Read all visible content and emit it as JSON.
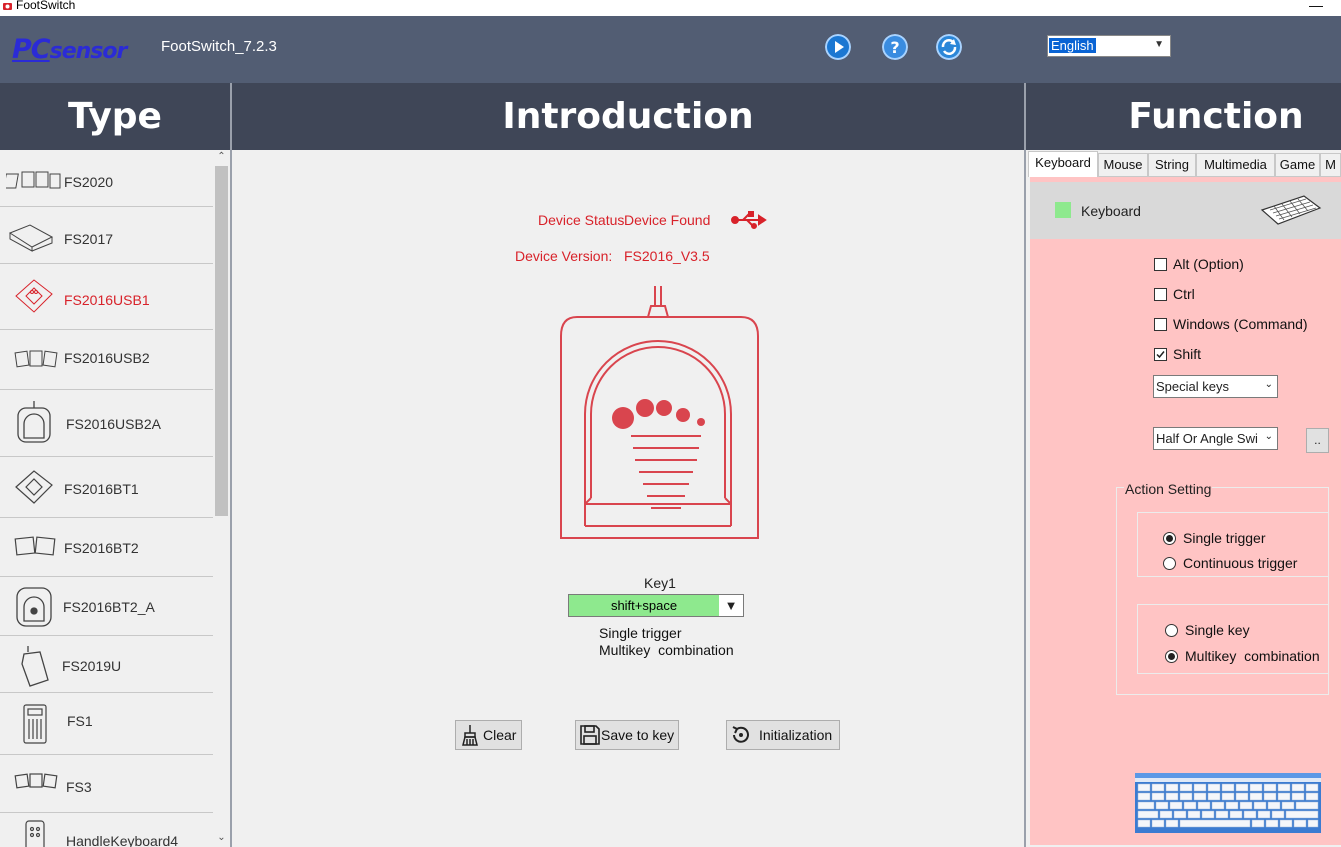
{
  "window": {
    "title": "FootSwitch"
  },
  "header": {
    "app_name": "FootSwitch_7.2.3",
    "logo_text": "PCsensor",
    "language": "English"
  },
  "sections": {
    "type": "Type",
    "introduction": "Introduction",
    "function": "Function"
  },
  "devices": [
    {
      "name": "FS2020",
      "selected": false
    },
    {
      "name": "FS2017",
      "selected": false
    },
    {
      "name": "FS2016USB1",
      "selected": true
    },
    {
      "name": "FS2016USB2",
      "selected": false
    },
    {
      "name": "FS2016USB2A",
      "selected": false
    },
    {
      "name": "FS2016BT1",
      "selected": false
    },
    {
      "name": "FS2016BT2",
      "selected": false
    },
    {
      "name": "FS2016BT2_A",
      "selected": false
    },
    {
      "name": "FS2019U",
      "selected": false
    },
    {
      "name": "FS1",
      "selected": false
    },
    {
      "name": "FS3",
      "selected": false
    },
    {
      "name": "HandleKeyboard4",
      "selected": false
    }
  ],
  "intro": {
    "status_label": "Device Status",
    "status_value": "Device Found",
    "version_label": "Device Version:",
    "version_value": "FS2016_V3.5",
    "key_label": "Key1",
    "key_value": "shift+space",
    "trigger_mode": "Single trigger",
    "key_mode": "Multikey  combination",
    "buttons": {
      "clear": "Clear",
      "save": "Save to key",
      "init": "Initialization"
    }
  },
  "function": {
    "tabs": [
      "Keyboard",
      "Mouse",
      "String",
      "Multimedia",
      "Game",
      "M"
    ],
    "active_tab": "Keyboard",
    "header_label": "Keyboard",
    "modifiers": [
      {
        "label": "Alt (Option)",
        "checked": false
      },
      {
        "label": "Ctrl",
        "checked": false
      },
      {
        "label": "Windows (Command)",
        "checked": false
      },
      {
        "label": "Shift",
        "checked": true
      }
    ],
    "special_keys": "Special keys",
    "half_angle": "Half Or Angle Swi",
    "dots_button": "..",
    "action_setting": "Action Setting",
    "trigger_options": [
      {
        "label": "Single trigger",
        "selected": true
      },
      {
        "label": "Continuous trigger",
        "selected": false
      }
    ],
    "key_options": [
      {
        "label": "Single key",
        "selected": false
      },
      {
        "label": "Multikey  combination",
        "selected": true
      }
    ]
  },
  "colors": {
    "header_bg": "#525d73",
    "section_bg": "#3f4657",
    "accent_red": "#d8222a",
    "panel_pink": "#ffc4c4",
    "key_green": "#8ee98e"
  }
}
